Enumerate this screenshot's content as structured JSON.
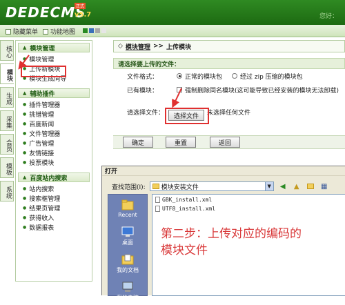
{
  "header": {
    "logo": "DEDECMS",
    "version": "v5.7",
    "badge": "正式",
    "right_text": "您好："
  },
  "toolbar": {
    "hide_menu": "隐藏菜单",
    "func_map": "功能地图",
    "swatch_colors": [
      "#2a8a23",
      "#3b70b9",
      "#a7a7a7",
      "#e6e6e6"
    ]
  },
  "vtabs": [
    "核心",
    "模块",
    "生成",
    "采集",
    "会员",
    "模板",
    "系统"
  ],
  "sidebar": {
    "sections": [
      {
        "title": "模块管理",
        "items": [
          "模块管理",
          "上传新模块",
          "模块生成向导"
        ]
      },
      {
        "title": "辅助插件",
        "items": [
          "插件管理器",
          "挑错管理",
          "百度新闻",
          "文件管理器",
          "广告管理",
          "友情链接",
          "投票模块"
        ]
      },
      {
        "title": "百度站内搜索",
        "items": [
          "站内搜索",
          "搜索框管理",
          "结果页管理",
          "获得收入",
          "数据报表"
        ]
      }
    ]
  },
  "main": {
    "breadcrumb_prefix": "◇",
    "breadcrumb_link": "模块管理",
    "breadcrumb_sep": ">>",
    "breadcrumb_current": "上传模块",
    "section_title": "请选择要上传的文件：",
    "format_label": "文件格式：",
    "format_opt1": "正常的模块包",
    "format_opt2": "经过 zip 压缩的模块包",
    "existing_label": "已有模块：",
    "existing_opt": "强制删除同名模块(这可能导致已经安装的模块无法卸载)",
    "file_label": "请选择文件：",
    "choose_file_btn": "选择文件",
    "no_file_text": "未选择任何文件",
    "confirm_btn": "确定",
    "reset_btn": "重置",
    "back_btn": "返回"
  },
  "dialog": {
    "title": "打开",
    "look_in_label": "查找范围(I):",
    "folder": "模块安装文件",
    "places": [
      "Recent",
      "桌面",
      "我的文档",
      "我的电脑"
    ],
    "files": [
      "GBK_install.xml",
      "UTF8_install.xml"
    ]
  },
  "annotation": {
    "line1": "第二步：上传对应的编码的",
    "line2": "模块文件"
  }
}
